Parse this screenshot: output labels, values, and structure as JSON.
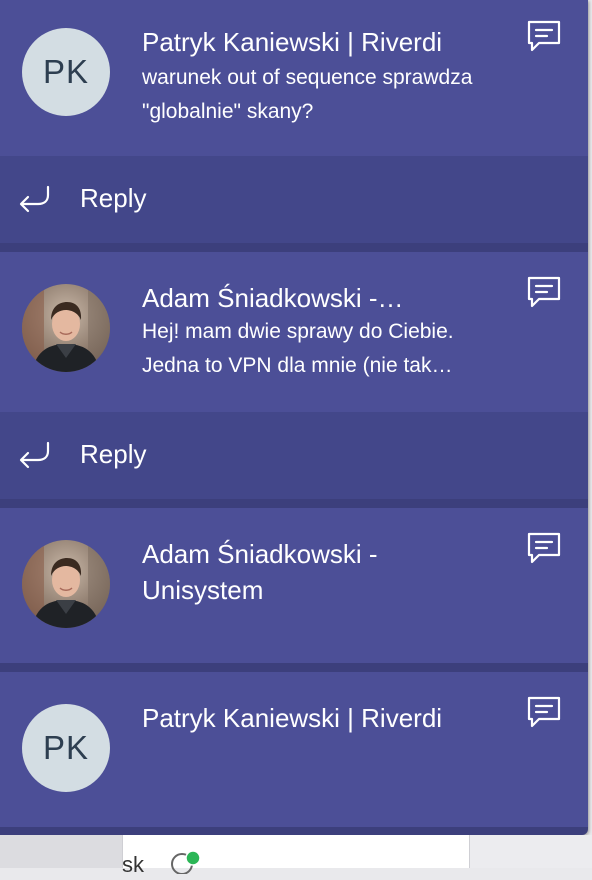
{
  "notifications": [
    {
      "sender": "Patryk Kaniewski | Riverdi",
      "avatar_initials": "PK",
      "avatar_type": "initials",
      "preview_lines": [
        "warunek out of sequence sprawdza",
        "\"globalnie\" skany?"
      ],
      "reply_label": "Reply",
      "chat_icon": "chat-bubble-icon",
      "reply_icon": "reply-arrow-icon"
    },
    {
      "sender": "Adam Śniadkowski -…",
      "avatar_type": "photo",
      "preview_lines": [
        "Hej! mam dwie sprawy do Ciebie.",
        "Jedna to VPN dla mnie (nie tak…"
      ],
      "reply_label": "Reply",
      "chat_icon": "chat-bubble-icon",
      "reply_icon": "reply-arrow-icon"
    },
    {
      "sender": "Adam Śniadkowski - Unisystem",
      "avatar_type": "photo",
      "chat_icon": "chat-bubble-icon"
    },
    {
      "sender": "Patryk Kaniewski | Riverdi",
      "avatar_initials": "PK",
      "avatar_type": "initials",
      "chat_icon": "chat-bubble-icon"
    }
  ],
  "background_peek": {
    "text": "sk",
    "presence_icon": "presence-available-icon",
    "presence_color": "#2bb656"
  },
  "colors": {
    "card": "#4c4f97",
    "reply_bar": "#43478a",
    "separator": "#3c3f7c",
    "avatar_initials_bg": "#d3dde3",
    "avatar_initials_fg": "#2d3e50"
  }
}
